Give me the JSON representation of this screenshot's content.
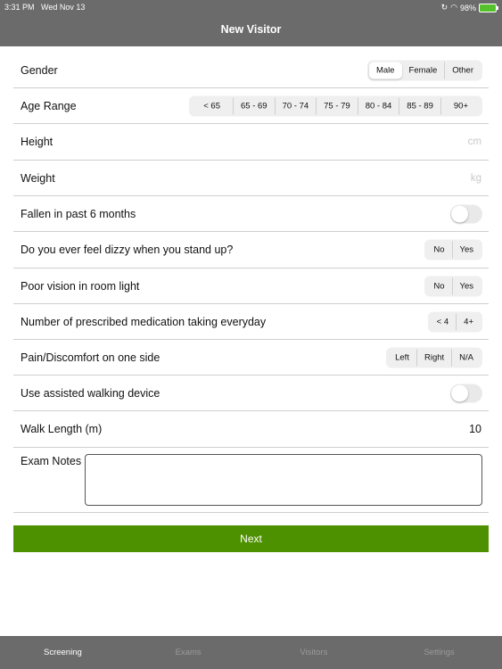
{
  "status_bar": {
    "time": "3:31 PM",
    "date": "Wed Nov 13",
    "battery": "98%"
  },
  "header": {
    "title": "New Visitor"
  },
  "form": {
    "gender": {
      "label": "Gender",
      "options": [
        "Male",
        "Female",
        "Other"
      ],
      "selected": "Male"
    },
    "age_range": {
      "label": "Age Range",
      "options": [
        "< 65",
        "65 - 69",
        "70 - 74",
        "75 - 79",
        "80 - 84",
        "85 - 89",
        "90+"
      ]
    },
    "height": {
      "label": "Height",
      "unit": "cm"
    },
    "weight": {
      "label": "Weight",
      "unit": "kg"
    },
    "fallen": {
      "label": "Fallen in past 6 months",
      "on": false
    },
    "dizzy": {
      "label": "Do you ever feel dizzy when you stand up?",
      "options": [
        "No",
        "Yes"
      ]
    },
    "vision": {
      "label": "Poor vision in room light",
      "options": [
        "No",
        "Yes"
      ]
    },
    "medication": {
      "label": "Number of prescribed medication taking everyday",
      "options": [
        "< 4",
        "4+"
      ]
    },
    "pain": {
      "label": "Pain/Discomfort on one side",
      "options": [
        "Left",
        "Right",
        "N/A"
      ]
    },
    "walking_device": {
      "label": "Use assisted walking device",
      "on": false
    },
    "walk_length": {
      "label": "Walk Length (m)",
      "value": "10"
    },
    "exam_notes": {
      "label": "Exam Notes",
      "value": ""
    }
  },
  "next_button": {
    "label": "Next"
  },
  "tabs": [
    {
      "label": "Screening",
      "active": true
    },
    {
      "label": "Exams",
      "active": false
    },
    {
      "label": "Visitors",
      "active": false
    },
    {
      "label": "Settings",
      "active": false
    }
  ]
}
